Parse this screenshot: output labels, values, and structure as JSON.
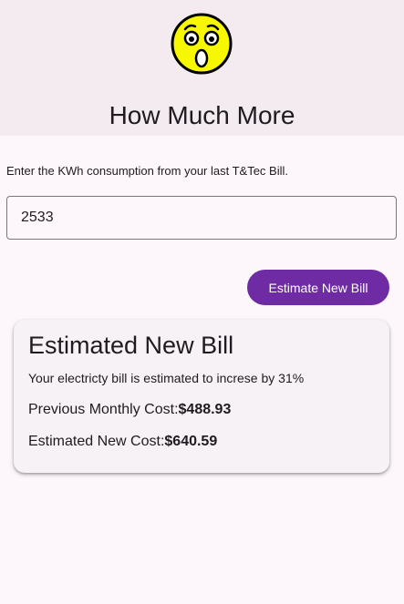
{
  "header": {
    "icon": "astonished-face-emoji-icon",
    "title": "How Much More"
  },
  "form": {
    "prompt": "Enter the KWh consumption from your last T&Tec Bill.",
    "kwh_value": "2533",
    "button_label": "Estimate New Bill"
  },
  "result": {
    "title": "Estimated New Bill",
    "description": "Your electricty bill is estimated to increse by 31%",
    "previous_label": "Previous Monthly Cost:",
    "previous_value": "$488.93",
    "new_label": "Estimated New Cost:",
    "new_value": "$640.59"
  },
  "colors": {
    "accent": "#6f2ba3",
    "emoji_face": "#f7f700",
    "header_bg": "#f3ebf0",
    "page_bg": "#fdf7fb"
  }
}
